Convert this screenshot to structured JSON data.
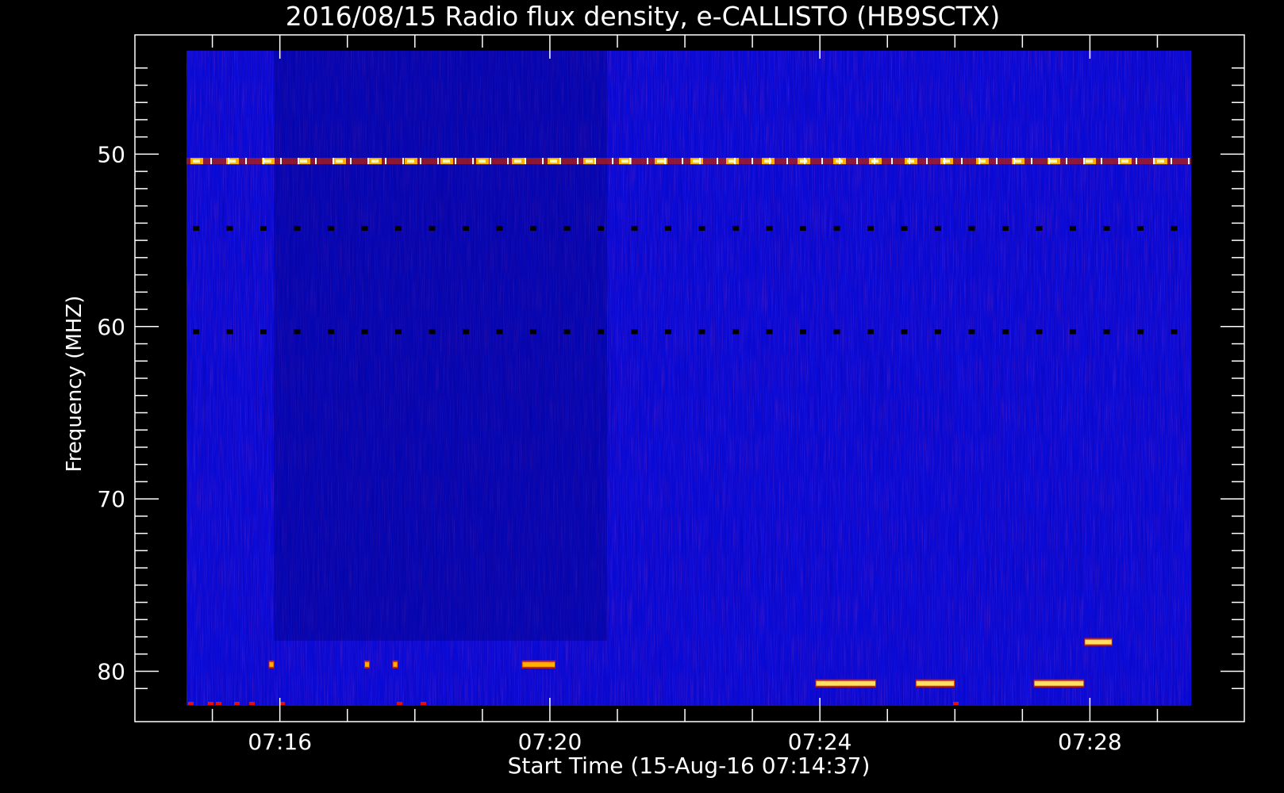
{
  "chart_data": {
    "type": "heatmap",
    "title": "2016/08/15  Radio flux density, e-CALLISTO (HB9SCTX)",
    "xlabel": "Start Time (15-Aug-16 07:14:37)",
    "ylabel": "Frequency (MHZ)",
    "x_ticks": [
      "07:16",
      "07:20",
      "07:24",
      "07:28"
    ],
    "y_ticks": [
      50,
      60,
      70,
      80
    ],
    "y_inverted": true,
    "background_color": "#0a0ad6",
    "bands": [
      {
        "feature": "intermittent interference",
        "frequency_mhz": 50.4,
        "start": "07:14:37",
        "end": "07:29:30",
        "color": "#ffb000"
      },
      {
        "feature": "dark dashes",
        "frequency_mhz": 54.3,
        "start": "07:14:37",
        "end": "07:29:30",
        "color": "#000000"
      },
      {
        "feature": "dark dashes",
        "frequency_mhz": 60.3,
        "start": "07:14:37",
        "end": "07:29:30",
        "color": "#000000"
      }
    ],
    "bursts": [
      {
        "frequency_mhz": 80.7,
        "start": "07:23:56",
        "end": "07:24:50",
        "color": "#ffe060"
      },
      {
        "frequency_mhz": 80.7,
        "start": "07:25:25",
        "end": "07:26:00",
        "color": "#ffe060"
      },
      {
        "frequency_mhz": 80.7,
        "start": "07:27:10",
        "end": "07:27:55",
        "color": "#ffe060"
      },
      {
        "frequency_mhz": 78.3,
        "start": "07:27:55",
        "end": "07:28:20",
        "color": "#ffe060"
      },
      {
        "frequency_mhz": 79.6,
        "start": "07:19:35",
        "end": "07:20:05",
        "color": "#ffb000"
      },
      {
        "frequency_mhz": 79.6,
        "start": "07:15:50",
        "end": "07:15:55",
        "color": "#ffb000"
      },
      {
        "frequency_mhz": 79.6,
        "start": "07:17:15",
        "end": "07:17:20",
        "color": "#ffb000"
      },
      {
        "frequency_mhz": 79.6,
        "start": "07:17:40",
        "end": "07:17:45",
        "color": "#ffb000"
      }
    ]
  }
}
